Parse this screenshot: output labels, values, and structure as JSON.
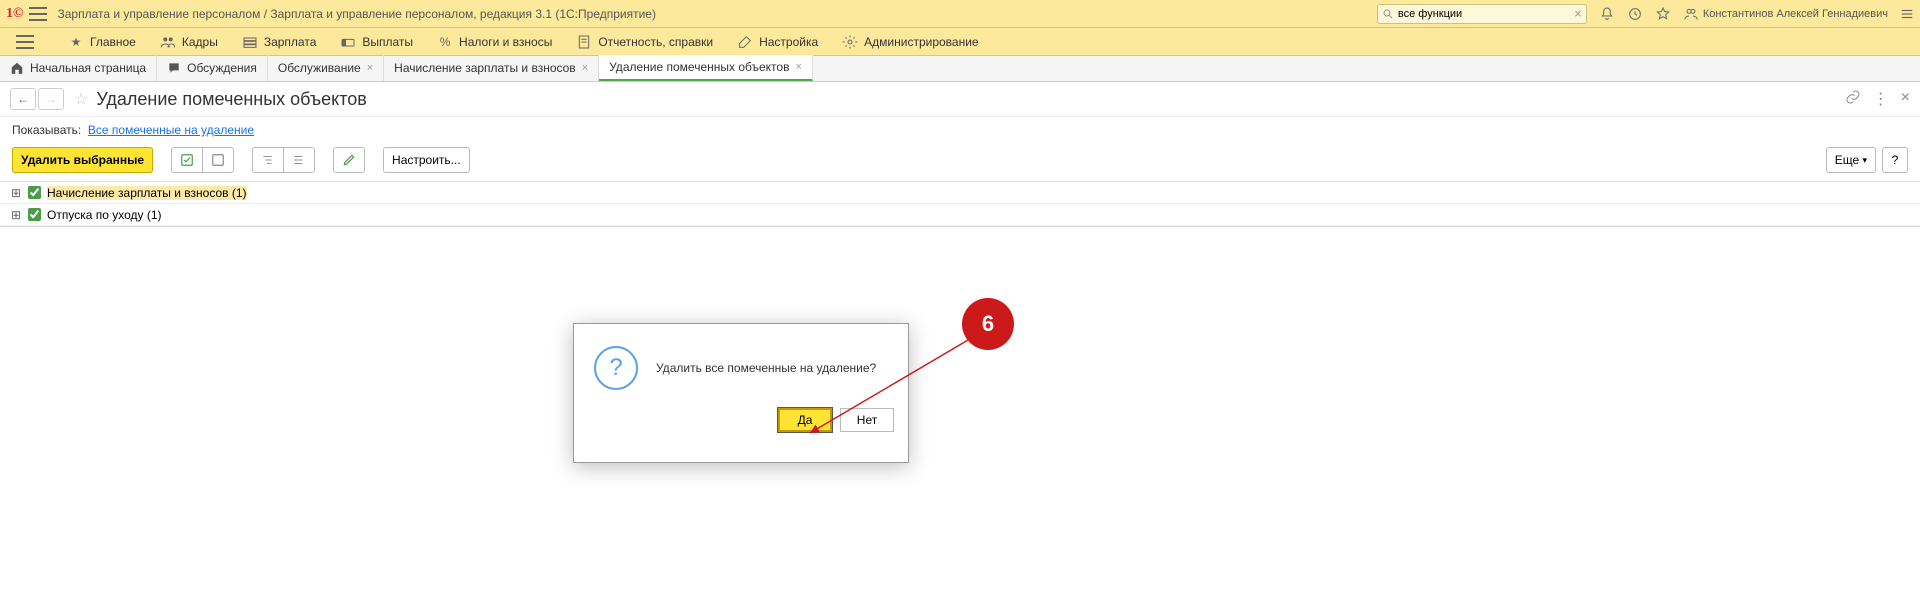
{
  "titlebar": {
    "app_title": "Зарплата и управление персоналом / Зарплата и управление персоналом, редакция 3.1  (1С:Предприятие)",
    "search_value": "все функции",
    "user_name": "Константинов Алексей Геннадиевич"
  },
  "mainmenu": [
    {
      "label": "Главное"
    },
    {
      "label": "Кадры"
    },
    {
      "label": "Зарплата"
    },
    {
      "label": "Выплаты"
    },
    {
      "label": "Налоги и взносы"
    },
    {
      "label": "Отчетность, справки"
    },
    {
      "label": "Настройка"
    },
    {
      "label": "Администрирование"
    }
  ],
  "tabs": [
    {
      "label": "Начальная страница",
      "closable": false
    },
    {
      "label": "Обсуждения",
      "closable": false
    },
    {
      "label": "Обслуживание",
      "closable": true
    },
    {
      "label": "Начисление зарплаты и взносов",
      "closable": true
    },
    {
      "label": "Удаление помеченных объектов",
      "closable": true,
      "active": true
    }
  ],
  "page": {
    "title": "Удаление помеченных объектов",
    "filter_label": "Показывать:",
    "filter_link": "Все помеченные на удаление",
    "delete_selected_btn": "Удалить выбранные",
    "configure_btn": "Настроить...",
    "more_btn": "Еще",
    "help_btn": "?"
  },
  "tree": [
    {
      "label": "Начисление зарплаты и взносов (1)",
      "checked": true,
      "selected": true
    },
    {
      "label": "Отпуска по уходу (1)",
      "checked": true,
      "selected": false
    }
  ],
  "dialog": {
    "message": "Удалить все помеченные на удаление?",
    "yes": "Да",
    "no": "Нет"
  },
  "callout": {
    "num": "6"
  }
}
